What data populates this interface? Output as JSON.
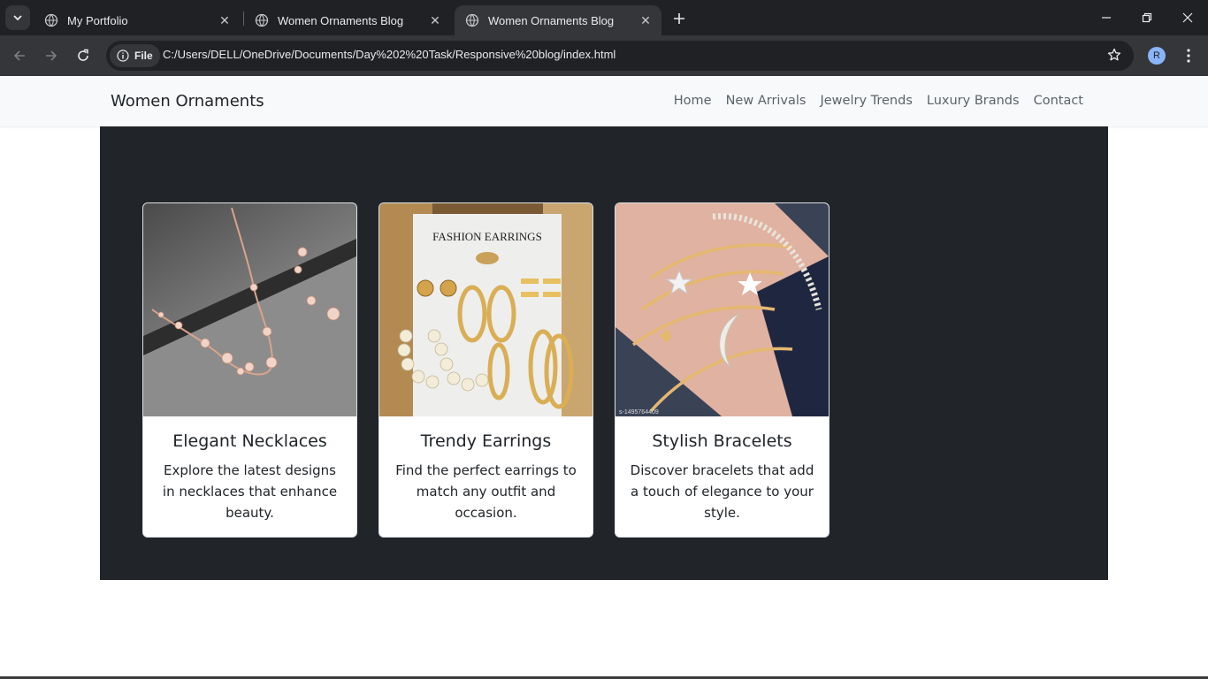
{
  "browser": {
    "tabs": [
      {
        "title": "My Portfolio",
        "active": false
      },
      {
        "title": "Women Ornaments Blog",
        "active": false
      },
      {
        "title": "Women Ornaments Blog",
        "active": true
      }
    ],
    "chip_label": "File",
    "url": "C:/Users/DELL/OneDrive/Documents/Day%202%20Task/Responsive%20blog/index.html",
    "avatar_initial": "R"
  },
  "site": {
    "brand": "Women Ornaments",
    "nav": [
      "Home",
      "New Arrivals",
      "Jewelry Trends",
      "Luxury Brands",
      "Contact"
    ]
  },
  "cards": [
    {
      "title": "Elegant Necklaces",
      "text": "Explore the latest designs in necklaces that enhance beauty.",
      "image": "necklace-photo"
    },
    {
      "title": "Trendy Earrings",
      "text": "Find the perfect earrings to match any outfit and occasion.",
      "image": "earrings-photo",
      "image_text": "FASHION EARRINGS"
    },
    {
      "title": "Stylish Bracelets",
      "text": "Discover bracelets that add a touch of elegance to your style.",
      "image": "bracelets-photo",
      "image_text": "s-1495764409"
    }
  ],
  "colors": {
    "hero_bg": "#212529",
    "navbar_bg": "#f8f9fa",
    "chrome_dark": "#202124",
    "chrome_mid": "#35363a"
  }
}
